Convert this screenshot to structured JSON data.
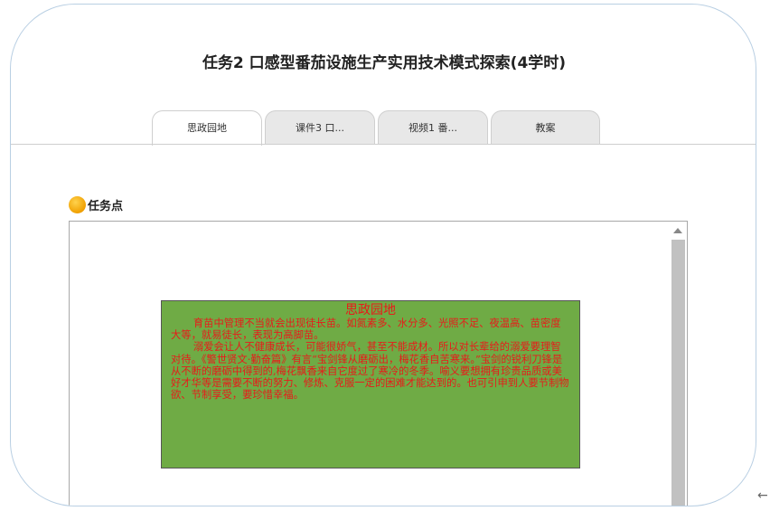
{
  "page": {
    "title": "任务2 口感型番茄设施生产实用技术模式探索(4学时)"
  },
  "tabs": [
    {
      "label": "思政园地",
      "active": true
    },
    {
      "label": "课件3 口...",
      "active": false
    },
    {
      "label": "视频1 番...",
      "active": false
    },
    {
      "label": "教案",
      "active": false
    }
  ],
  "section": {
    "label": "任务点",
    "icon": "orange-dot-icon"
  },
  "content": {
    "box_title": "思政园地",
    "paragraphs": [
      "育苗中管理不当就会出现徒长苗。如氮素多、水分多、光照不足、夜温高、苗密度大等，就易徒长，表现为高脚苗。",
      "溺爱会让人不健康成长，可能很娇气，甚至不能成材。所以对长辈给的溺爱要理智对待。《警世贤文·勤奋篇》有言“宝剑锋从磨砺出，梅花香自苦寒来。”宝剑的锐利刀锋是从不断的磨砺中得到的,梅花飘香来自它度过了寒冷的冬季。喻义要想拥有珍贵品质或美好才华等是需要不断的努力、修炼、克服一定的困难才能达到的。也可引申到人要节制物欲、节制享受，要珍惜幸福。"
    ],
    "box_color": "#6fab45",
    "text_color": "#e81a1a"
  },
  "nav": {
    "back_icon": "←"
  }
}
